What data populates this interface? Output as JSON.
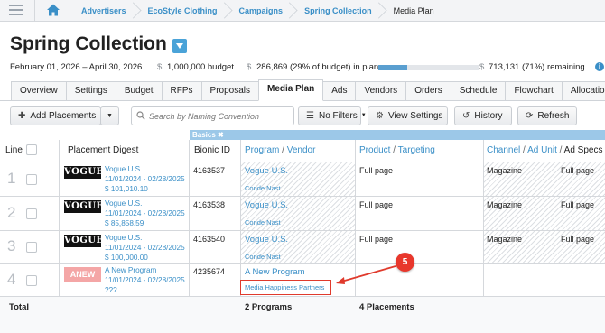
{
  "breadcrumb": {
    "items": [
      "Advertisers",
      "EcoStyle Clothing",
      "Campaigns",
      "Spring Collection"
    ],
    "current": "Media Plan"
  },
  "page": {
    "title": "Spring Collection",
    "date_range": "February 01, 2026 – April 30, 2026",
    "budget_currency": "$",
    "budget": "1,000,000 budget",
    "inplan_currency": "$",
    "in_plan": "286,869 (29% of budget) in plan",
    "in_plan_fraction": 0.29,
    "remaining_currency": "$",
    "remaining": "713,131 (71%) remaining",
    "remaining_fraction": 0.71,
    "info_icon": "i"
  },
  "tabs": [
    "Overview",
    "Settings",
    "Budget",
    "RFPs",
    "Proposals",
    "Media Plan",
    "Ads",
    "Vendors",
    "Orders",
    "Schedule",
    "Flowchart",
    "Allocation"
  ],
  "active_tab": "Media Plan",
  "toolbar": {
    "add_label": "Add Placements",
    "search_placeholder": "Search by Naming Convention",
    "filters_label": "No Filters",
    "view_settings_label": "View Settings",
    "history_label": "History",
    "refresh_label": "Refresh"
  },
  "table": {
    "section_tag": "Basics ✖",
    "headers": {
      "line": "Line",
      "digest": "Placement Digest",
      "bionic": "Bionic ID",
      "program": "Program",
      "vendor": "Vendor",
      "product": "Product",
      "targeting": "Targeting",
      "channel": "Channel",
      "ad_unit": "Ad Unit",
      "ad_specs": "Ad Specs",
      "slash": "/"
    },
    "rows": [
      {
        "line": "1",
        "logo": "VOGUE",
        "name": "Vogue U.S.",
        "dates": "11/01/2024 - 02/28/2025",
        "cost": "$ 101,010.10",
        "bionic_id": "4163537",
        "program": "Vogue U.S.",
        "vendor": "Conde Nast",
        "product": "Full page",
        "channel": "Magazine",
        "ad_unit": "Full page"
      },
      {
        "line": "2",
        "logo": "VOGUE",
        "name": "Vogue U.S.",
        "dates": "11/01/2024 - 02/28/2025",
        "cost": "$ 85,858.59",
        "bionic_id": "4163538",
        "program": "Vogue U.S.",
        "vendor": "Conde Nast",
        "product": "Full page",
        "channel": "Magazine",
        "ad_unit": "Full page"
      },
      {
        "line": "3",
        "logo": "VOGUE",
        "name": "Vogue U.S.",
        "dates": "11/01/2024 - 02/28/2025",
        "cost": "$ 100,000.00",
        "bionic_id": "4163540",
        "program": "Vogue U.S.",
        "vendor": "Conde Nast",
        "product": "Full page",
        "channel": "Magazine",
        "ad_unit": "Full page"
      },
      {
        "line": "4",
        "logo": "ANEW",
        "name": "A New Program",
        "dates": "11/01/2024 - 02/28/2025",
        "cost": "???",
        "bionic_id": "4235674",
        "program": "A New Program",
        "vendor": "Media Happiness Partners",
        "product": "",
        "channel": "",
        "ad_unit": ""
      }
    ],
    "total": {
      "label": "Total",
      "programs": "2 Programs",
      "placements": "4 Placements"
    }
  },
  "annotation": {
    "badge": "5",
    "color": "#e8372c"
  },
  "colors": {
    "link": "#3a8fc7",
    "accent": "#4aa3d8",
    "basics_band": "#9cc8e8",
    "anew_badge": "#f4a6a6"
  }
}
